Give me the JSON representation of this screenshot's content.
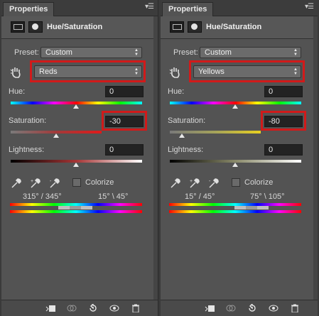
{
  "left": {
    "tab": "Properties",
    "title": "Hue/Saturation",
    "preset_label": "Preset:",
    "preset_value": "Custom",
    "channel_value": "Reds",
    "hue_label": "Hue:",
    "hue_value": "0",
    "saturation_label": "Saturation:",
    "saturation_value": "-30",
    "lightness_label": "Lightness:",
    "lightness_value": "0",
    "colorize_label": "Colorize",
    "range_left": "315° / 345°",
    "range_right": "15° \\ 45°"
  },
  "right": {
    "tab": "Properties",
    "title": "Hue/Saturation",
    "preset_label": "Preset:",
    "preset_value": "Custom",
    "channel_value": "Yellows",
    "hue_label": "Hue:",
    "hue_value": "0",
    "saturation_label": "Saturation:",
    "saturation_value": "-80",
    "lightness_label": "Lightness:",
    "lightness_value": "0",
    "colorize_label": "Colorize",
    "range_left": "15° / 45°",
    "range_right": "75° \\ 105°"
  },
  "colors": {
    "highlight": "#d11a1a",
    "panel": "#535353"
  }
}
